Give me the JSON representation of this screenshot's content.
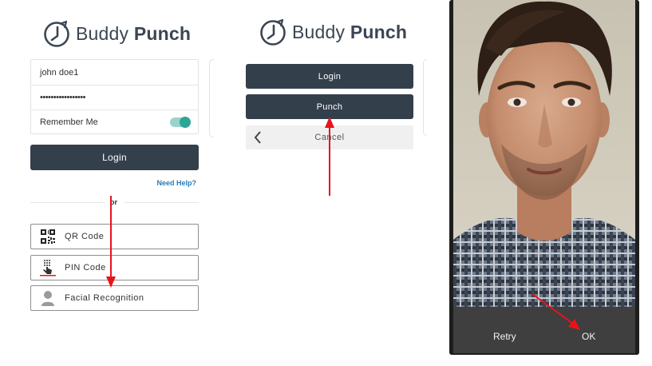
{
  "brand": {
    "word_regular": "Buddy",
    "word_bold": "Punch",
    "accent": "#343f4c",
    "toggle_color": "#2ea597",
    "link_color": "#2a7ab8",
    "arrow_color": "#e8131b"
  },
  "login_panel": {
    "username_value": "john doe1",
    "password_value": "•••••••••••••••••",
    "remember_label": "Remember Me",
    "remember_checked": true,
    "login_label": "Login",
    "help_link": "Need Help?",
    "or_label": "or",
    "options": [
      {
        "label": "QR Code",
        "icon": "qr-code-icon"
      },
      {
        "label": "PIN Code",
        "icon": "pin-code-icon"
      },
      {
        "label": "Facial Recognition",
        "icon": "person-icon"
      }
    ]
  },
  "action_panel": {
    "login_label": "Login",
    "punch_label": "Punch",
    "cancel_label": "Cancel",
    "back_icon": "chevron-left-icon"
  },
  "camera_panel": {
    "retry_label": "Retry",
    "ok_label": "OK"
  }
}
